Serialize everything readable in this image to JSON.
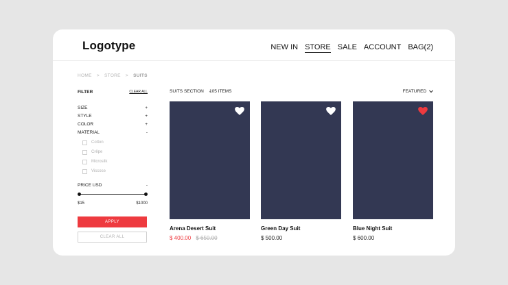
{
  "brand": {
    "logo": "Logotype"
  },
  "nav": {
    "items": [
      {
        "label": "NEW IN",
        "active": false
      },
      {
        "label": "STORE",
        "active": true
      },
      {
        "label": "SALE",
        "active": false
      },
      {
        "label": "ACCOUNT",
        "active": false
      },
      {
        "label": "BAG(2)",
        "active": false
      }
    ]
  },
  "breadcrumb": [
    "HOME",
    ">",
    "STORE",
    ">",
    "SUITS"
  ],
  "filter": {
    "title": "FILTER",
    "clear_all": "CLEAR ALL",
    "facets": [
      {
        "label": "SIZE",
        "toggle": "+"
      },
      {
        "label": "STYLE",
        "toggle": "+"
      },
      {
        "label": "COLOR",
        "toggle": "+"
      },
      {
        "label": "MATERIAL",
        "toggle": "-"
      }
    ],
    "material_options": [
      "Cotton",
      "Crêpe",
      "Microsilk",
      "Viscose"
    ],
    "price": {
      "label": "PRICE USD",
      "toggle": "-",
      "min": "$15",
      "max": "$1000"
    },
    "apply": "APPLY",
    "clear": "CLEAR ALL"
  },
  "toolbar": {
    "section": "SUITS SECTION",
    "section_toggle": "-",
    "count": "105 ITEMS",
    "sort": "FEATURED"
  },
  "products": [
    {
      "name": "Arena Desert Suit",
      "price": "$ 400.00",
      "old_price": "$ 650.00",
      "on_sale": true,
      "favorited": false
    },
    {
      "name": "Green Day Suit",
      "price": "$ 500.00",
      "old_price": "",
      "on_sale": false,
      "favorited": false
    },
    {
      "name": "Blue Night Suit",
      "price": "$ 600.00",
      "old_price": "",
      "on_sale": false,
      "favorited": true
    }
  ],
  "colors": {
    "accent": "#ee3a3f",
    "product_bg": "#333853",
    "page_bg": "#e6e6e6",
    "heart_on": "#ee3a3f",
    "heart_off": "#ffffff"
  }
}
